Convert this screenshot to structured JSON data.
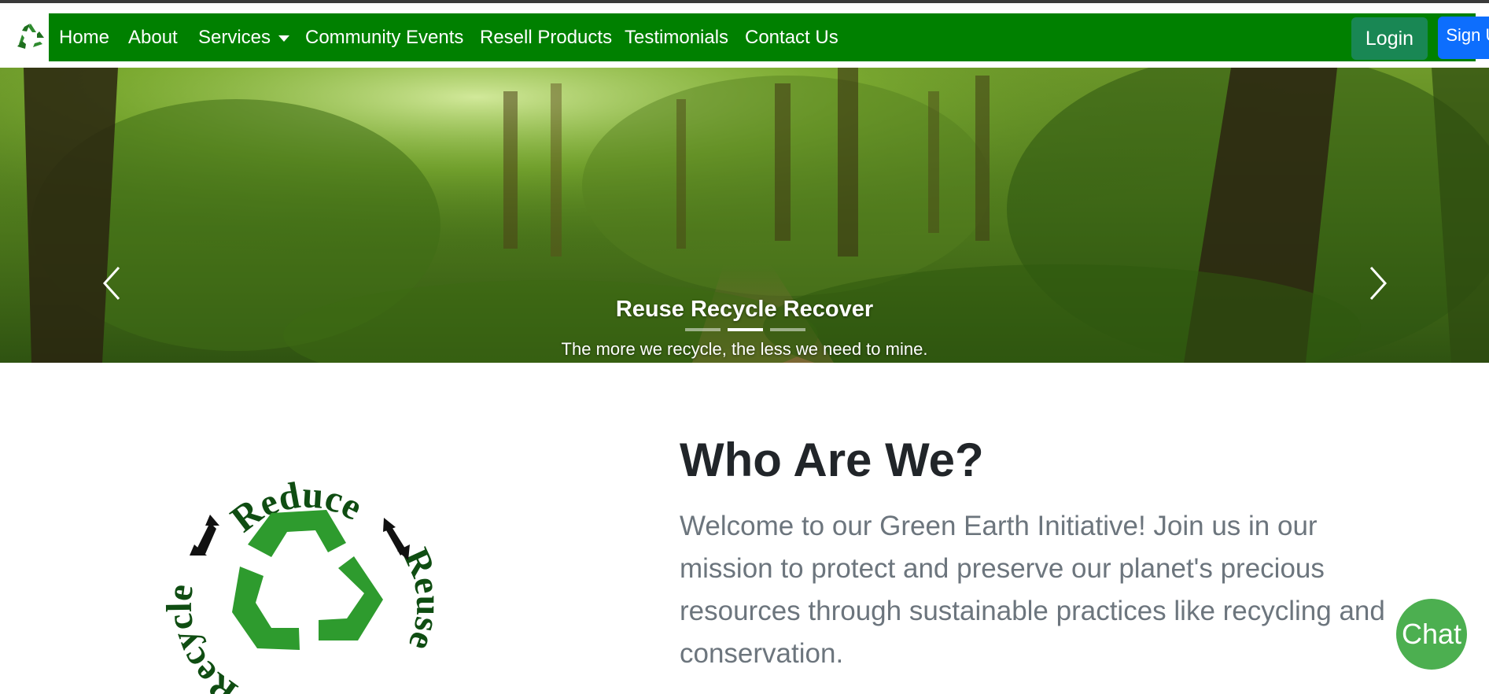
{
  "nav": {
    "items": [
      {
        "label": "Home"
      },
      {
        "label": "About"
      },
      {
        "label": "Services"
      },
      {
        "label": "Community Events"
      },
      {
        "label": "Resell Products"
      },
      {
        "label": "Testimonials"
      },
      {
        "label": "Contact Us"
      }
    ],
    "login_label": "Login",
    "signup_label": "Sign Up"
  },
  "carousel": {
    "title": "Reuse Recycle Recover",
    "text": "The more we recycle, the less we need to mine.",
    "slide_count": 3,
    "active_slide": 2
  },
  "about": {
    "title": "Who Are We?",
    "text": "Welcome to our Green Earth Initiative! Join us in our mission to protect and preserve our planet's precious resources through sustainable practices like recycling and conservation.",
    "emblem": {
      "top_word": "Reduce",
      "right_word": "Reuse",
      "left_word": "Recycle"
    }
  },
  "chat": {
    "label": "Chat"
  },
  "colors": {
    "nav_green": "#008000",
    "login_green": "#198754",
    "signup_blue": "#0d6efd",
    "chat_green": "#4caf50",
    "recycle_green": "#2e9b2e"
  }
}
